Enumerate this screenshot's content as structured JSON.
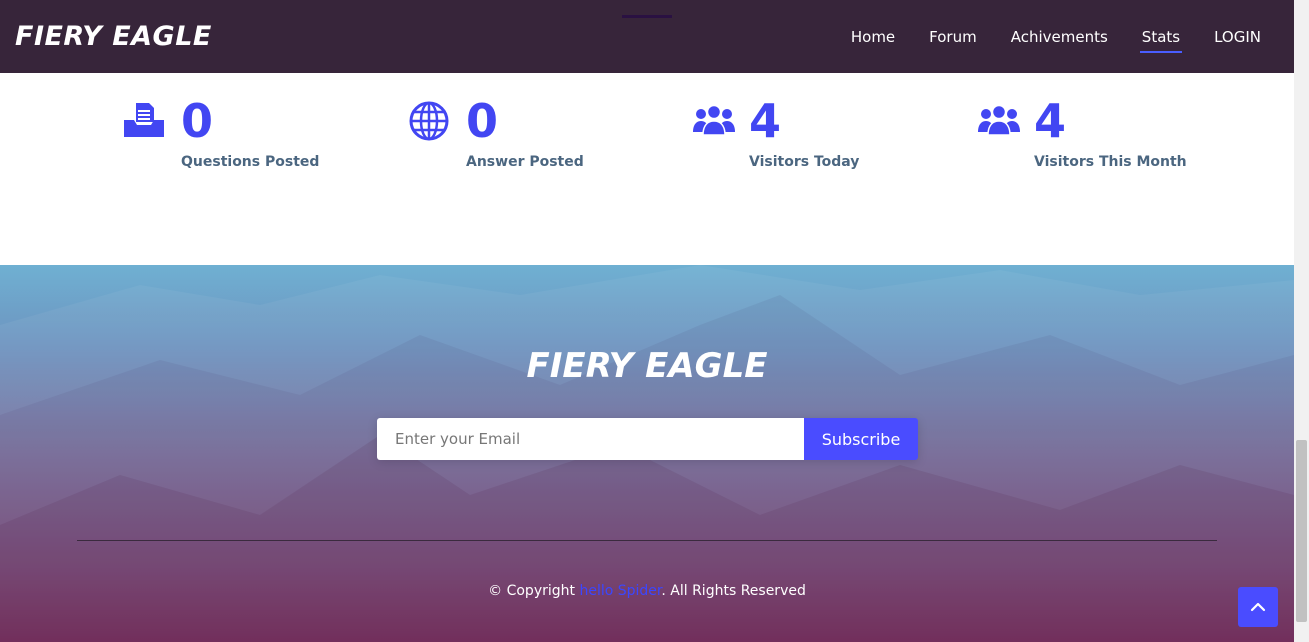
{
  "header": {
    "brand": "FIERY EAGLE",
    "nav": [
      {
        "label": "Home",
        "active": false
      },
      {
        "label": "Forum",
        "active": false
      },
      {
        "label": "Achivements",
        "active": false
      },
      {
        "label": "Stats",
        "active": true
      },
      {
        "label": "LOGIN",
        "active": false
      }
    ]
  },
  "stats": [
    {
      "icon": "inbox-icon",
      "value": "0",
      "label": "Questions Posted"
    },
    {
      "icon": "globe-icon",
      "value": "0",
      "label": "Answer Posted"
    },
    {
      "icon": "users-icon",
      "value": "4",
      "label": "Visitors Today"
    },
    {
      "icon": "users-icon",
      "value": "4",
      "label": "Visitors This Month"
    }
  ],
  "footer": {
    "brand": "FIERY EAGLE",
    "email_placeholder": "Enter your Email",
    "subscribe_label": "Subscribe",
    "copyright_prefix": "© Copyright ",
    "copyright_link": "hello Spider",
    "copyright_suffix": ". All Rights Reserved"
  },
  "back_to_top_icon": "chevron-up-icon",
  "colors": {
    "header_bg": "#37253a",
    "accent": "#4a4cff",
    "stat_value": "#4246f2",
    "stat_label": "#4b6680"
  }
}
